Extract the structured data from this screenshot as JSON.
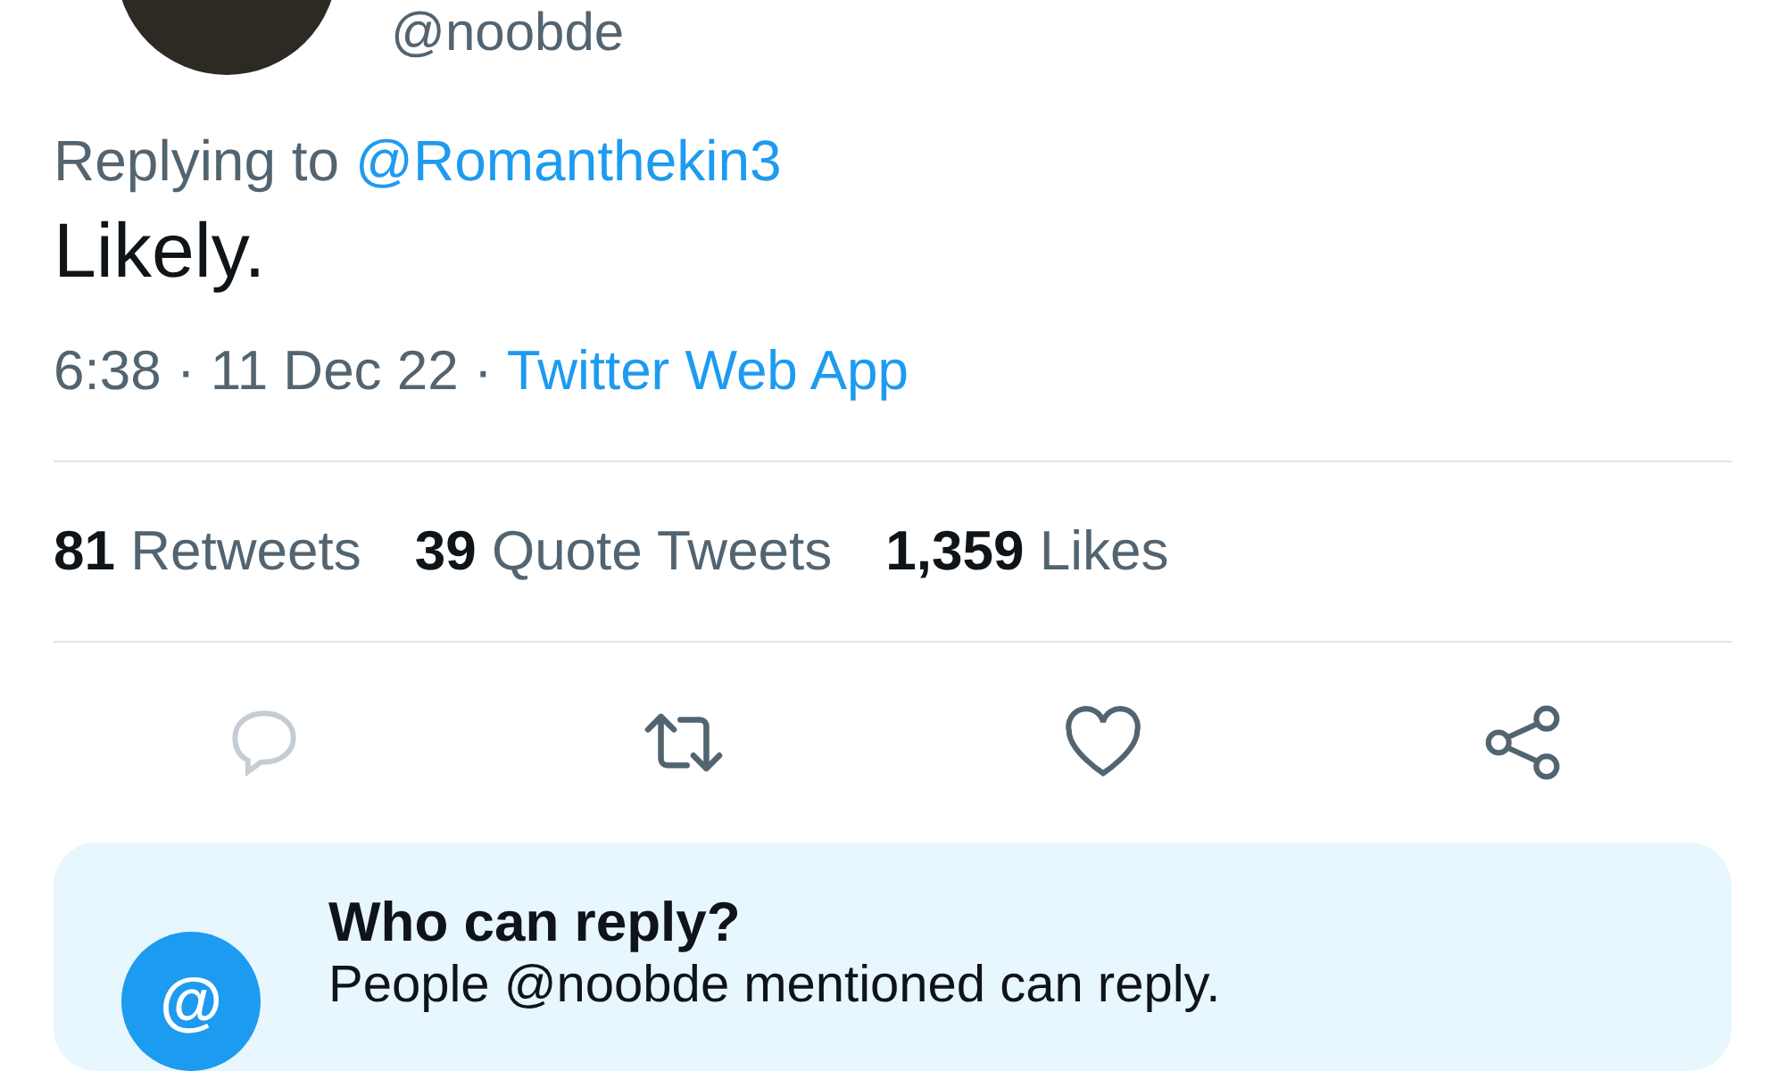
{
  "author": {
    "handle": "@noobde"
  },
  "tweet": {
    "replying_label": "Replying to",
    "replying_to": "@Romanthekin3",
    "text": "Likely.",
    "time": "6:38 · 11 Dec 22 ·",
    "source": "Twitter Web App"
  },
  "stats": [
    {
      "count": "81",
      "label": "Retweets"
    },
    {
      "count": "39",
      "label": "Quote Tweets"
    },
    {
      "count": "1,359",
      "label": "Likes"
    }
  ],
  "actions": [
    {
      "kind": "reply",
      "disabled": true
    },
    {
      "kind": "retweet",
      "disabled": false
    },
    {
      "kind": "like",
      "disabled": false
    },
    {
      "kind": "share",
      "disabled": false
    }
  ],
  "reply_notice": {
    "title": "Who can reply?",
    "text": "People @noobde mentioned can reply.",
    "icon_glyph": "@"
  }
}
